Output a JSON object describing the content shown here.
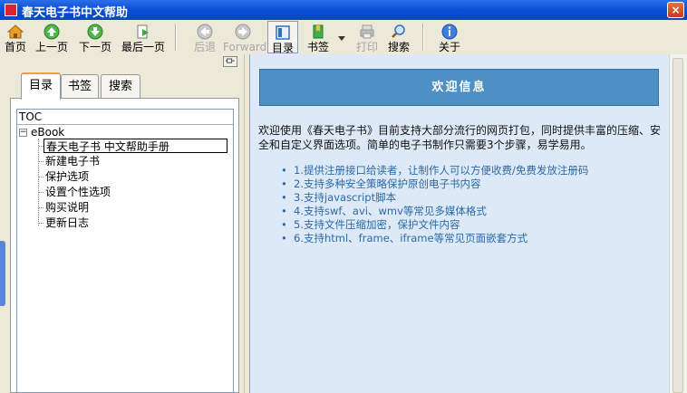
{
  "window": {
    "title": "春天电子书中文帮助",
    "close_symbol": "×"
  },
  "toolbar": [
    {
      "name": "home",
      "label": "首页",
      "icon": "home-icon",
      "color": "#d98a1e",
      "disabled": false
    },
    {
      "name": "prev-page",
      "label": "上一页",
      "icon": "arrow-up-icon",
      "color": "#39a93a",
      "disabled": false
    },
    {
      "name": "next-page",
      "label": "下一页",
      "icon": "arrow-down-icon",
      "color": "#39a93a",
      "disabled": false
    },
    {
      "name": "last-page",
      "label": "最后一页",
      "icon": "last-page-icon",
      "color": "#39a93a",
      "disabled": false
    },
    {
      "name": "back",
      "label": "后退",
      "icon": "back-arrow-icon",
      "color": "#9a9a9a",
      "disabled": true
    },
    {
      "name": "forward",
      "label": "Forward",
      "icon": "forward-arrow-icon",
      "color": "#9a9a9a",
      "disabled": true
    },
    {
      "name": "toc",
      "label": "目录",
      "icon": "toc-icon",
      "color": "#2f6fc4",
      "disabled": false
    },
    {
      "name": "bookmark",
      "label": "书签",
      "icon": "bookmark-icon",
      "color": "#2e9a3c",
      "disabled": false
    },
    {
      "name": "print",
      "label": "打印",
      "icon": "printer-icon",
      "color": "#9a9a9a",
      "disabled": true
    },
    {
      "name": "search",
      "label": "搜索",
      "icon": "search-icon",
      "color": "#3a6ec0",
      "disabled": false
    },
    {
      "name": "about",
      "label": "关于",
      "icon": "info-icon",
      "color": "#2f6fd6",
      "disabled": false
    }
  ],
  "tabs": [
    {
      "label": "目录",
      "active": true
    },
    {
      "label": "书签",
      "active": false
    },
    {
      "label": "搜索",
      "active": false
    }
  ],
  "tree": {
    "root": "TOC",
    "folder": "eBook",
    "expand_symbol": "−",
    "items": [
      "春天电子书 中文帮助手册",
      "新建电子书",
      "保护选项",
      "设置个性选项",
      "购买说明",
      "更新日志"
    ],
    "selected_index": 0
  },
  "content": {
    "banner": "欢迎信息",
    "intro": "欢迎使用《春天电子书》目前支持大部分流行的网页打包，同时提供丰富的压缩、安全和自定义界面选项。简单的电子书制作只需要3个步骤，易学易用。",
    "features": [
      "1.提供注册接口给读者，让制作人可以方便收费/免费发放注册码",
      "2.支持多种安全策略保护原创电子书内容",
      "3.支持javascript脚本",
      "4.支持swf、avi、wmv等常见多媒体格式",
      "5.支持文件压缩加密，保护文件内容",
      "6.支持html、frame、iframe等常见页面嵌套方式"
    ]
  },
  "colors": {
    "titlebar": "#0a4fd6",
    "banner": "#4e8fc4",
    "content_bg": "#dde9f7",
    "link": "#2b6aa6"
  }
}
